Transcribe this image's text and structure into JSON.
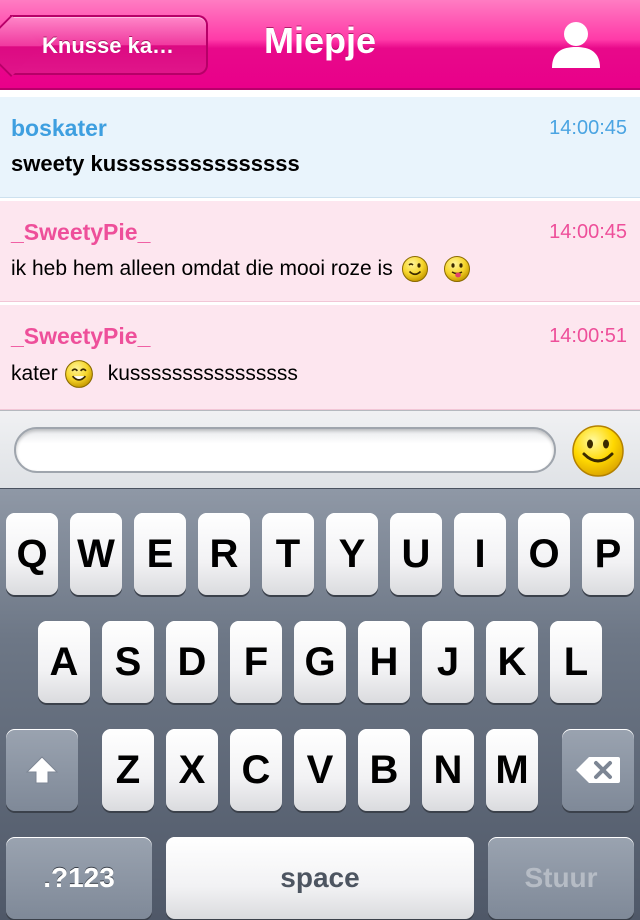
{
  "navbar": {
    "back_label": "Knusse ka…",
    "title": "Miepje",
    "profile_icon": "person-icon"
  },
  "messages": [
    {
      "author": "boskater",
      "time": "14:00:45",
      "text": "sweety kusssssssssssssss",
      "style": "blue"
    },
    {
      "author": "_SweetyPie_",
      "time": "14:00:45",
      "text_before": "ik heb hem alleen omdat die mooi roze is",
      "emoticons": [
        "wink-smiley-icon",
        "tongue-smiley-icon"
      ],
      "style": "pink"
    },
    {
      "author": "_SweetyPie_",
      "time": "14:00:51",
      "text_before": "kater",
      "text_after": "kussssssssssssssss",
      "emoticons": [
        "happy-smiley-icon"
      ],
      "style": "pink"
    }
  ],
  "input": {
    "value": "",
    "smiley_button_icon": "smiley-icon"
  },
  "keyboard": {
    "row1": [
      "Q",
      "W",
      "E",
      "R",
      "T",
      "Y",
      "U",
      "I",
      "O",
      "P"
    ],
    "row2": [
      "A",
      "S",
      "D",
      "F",
      "G",
      "H",
      "J",
      "K",
      "L"
    ],
    "row3": [
      "Z",
      "X",
      "C",
      "V",
      "B",
      "N",
      "M"
    ],
    "shift_icon": "shift-arrow-icon",
    "backspace_icon": "backspace-icon",
    "numbers_label": ".?123",
    "space_label": "space",
    "return_label": "Stuur"
  },
  "colors": {
    "nav_pink": "#e9008a",
    "blue_author": "#3e9fe0",
    "pink_author": "#ee4f9a",
    "blue_bubble_bg": "#e9f4fc",
    "pink_bubble_bg": "#fde6ef"
  }
}
